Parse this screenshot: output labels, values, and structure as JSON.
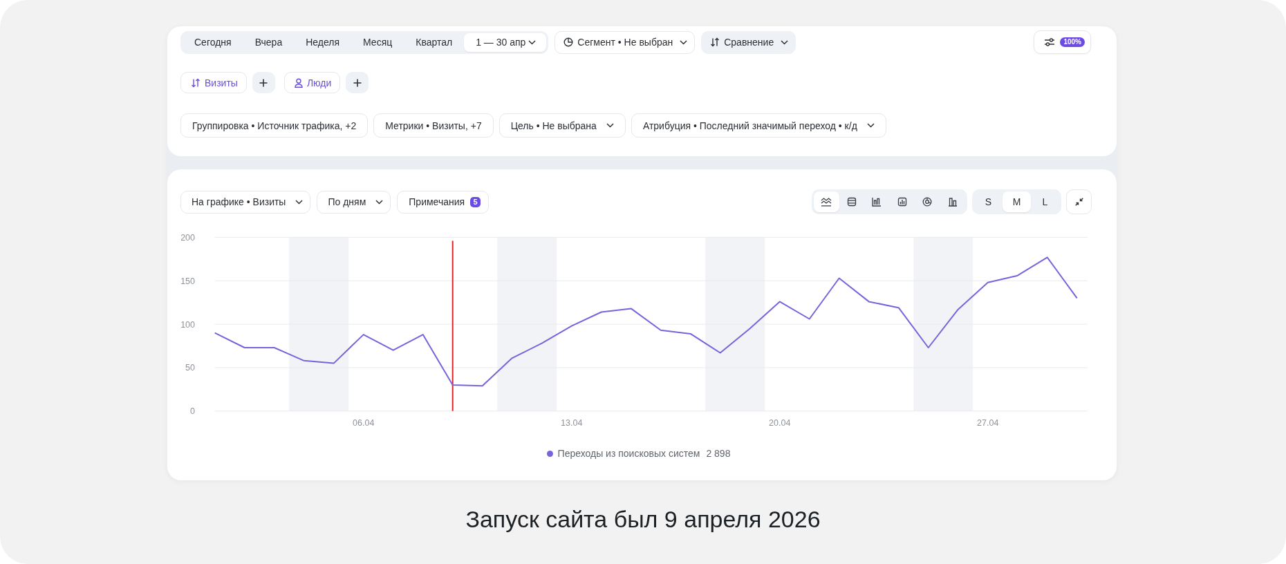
{
  "top_panel": {
    "period_tabs": [
      {
        "label": "Сегодня",
        "selected": false,
        "dropdown": false
      },
      {
        "label": "Вчера",
        "selected": false,
        "dropdown": false
      },
      {
        "label": "Неделя",
        "selected": false,
        "dropdown": false
      },
      {
        "label": "Месяц",
        "selected": false,
        "dropdown": false
      },
      {
        "label": "Квартал",
        "selected": false,
        "dropdown": false
      },
      {
        "label": "1 — 30 апр",
        "selected": true,
        "dropdown": true
      }
    ],
    "segment_button": {
      "label": "Сегмент • Не выбран"
    },
    "comparison_button": {
      "label": "Сравнение"
    },
    "settings_button": {
      "badge": "100%"
    },
    "metric_chips": [
      {
        "kind": "visits",
        "label": "Визиты"
      },
      {
        "kind": "people",
        "label": "Люди"
      }
    ],
    "filters": [
      {
        "label": "Группировка • Источник трафика, +2",
        "dropdown": false
      },
      {
        "label": "Метрики • Визиты, +7",
        "dropdown": false
      },
      {
        "label": "Цель • Не выбрана",
        "dropdown": true
      },
      {
        "label": "Атрибуция • Последний значимый переход • к/д",
        "dropdown": true
      }
    ]
  },
  "chart_panel": {
    "toolbar": {
      "dropdowns": [
        {
          "label": "На графике • Визиты",
          "dropdown": true
        },
        {
          "label": "По дням",
          "dropdown": true
        }
      ],
      "notes_button": {
        "label": "Примечания",
        "badge": "5"
      },
      "chart_types": [
        {
          "kind": "line",
          "selected": true
        },
        {
          "kind": "stacked",
          "selected": false
        },
        {
          "kind": "bar",
          "selected": false
        },
        {
          "kind": "framed",
          "selected": false
        },
        {
          "kind": "pie",
          "selected": false
        },
        {
          "kind": "column",
          "selected": false
        }
      ],
      "sizes": [
        {
          "label": "S",
          "selected": false
        },
        {
          "label": "M",
          "selected": true
        },
        {
          "label": "L",
          "selected": false
        }
      ]
    },
    "chart_data": {
      "type": "line",
      "categories": [
        null,
        null,
        null,
        null,
        null,
        "06.04",
        null,
        null,
        null,
        null,
        null,
        null,
        "13.04",
        null,
        null,
        null,
        null,
        null,
        null,
        "20.04",
        null,
        null,
        null,
        null,
        null,
        null,
        "27.04",
        null,
        null,
        null
      ],
      "ylim": [
        0,
        200
      ],
      "yticks": [
        0,
        50,
        100,
        150,
        200
      ],
      "grid": true,
      "series": [
        {
          "name": "Переходы из поисковых систем",
          "color": "#7a62dc",
          "values": [
            90,
            73,
            73,
            58,
            55,
            88,
            70,
            88,
            30,
            29,
            61,
            78,
            98,
            114,
            118,
            93,
            89,
            67,
            95,
            126,
            106,
            153,
            126,
            119,
            73,
            117,
            148,
            156,
            177,
            130
          ]
        }
      ]
    },
    "legend": {
      "totals": [
        "2 898"
      ]
    }
  },
  "caption": "Запуск сайта был 9 апреля 2026"
}
